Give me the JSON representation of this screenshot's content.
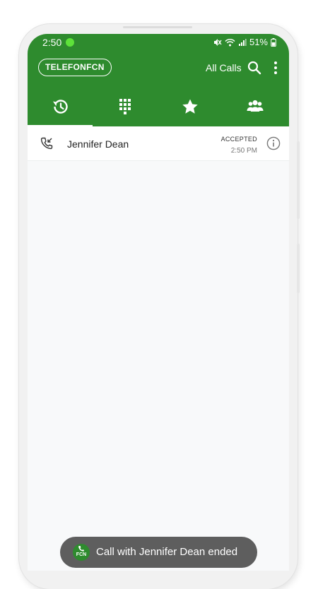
{
  "status_bar": {
    "time": "2:50",
    "battery": "51%",
    "icons": [
      "notification-dot",
      "mute-icon",
      "wifi-icon",
      "signal-icon",
      "battery-icon"
    ]
  },
  "app_bar": {
    "brand": "TELEFONFCN",
    "filter_label": "All Calls",
    "icons": [
      "search-icon",
      "more-vert-icon"
    ]
  },
  "tabs": [
    {
      "icon": "history-icon",
      "selected": true
    },
    {
      "icon": "dialpad-icon",
      "selected": false
    },
    {
      "icon": "star-icon",
      "selected": false
    },
    {
      "icon": "contacts-icon",
      "selected": false
    }
  ],
  "calls": [
    {
      "name": "Jennifer Dean",
      "status": "ACCEPTED",
      "time": "2:50 PM",
      "icon": "incoming-call-icon"
    }
  ],
  "toast": {
    "app_icon_text": "FCN",
    "message": "Call with Jennifer Dean ended"
  },
  "colors": {
    "primary": "#2e8b2e",
    "status_dot": "#5ee23a",
    "background": "#f8f9fa",
    "toast": "#5e5e5e"
  }
}
